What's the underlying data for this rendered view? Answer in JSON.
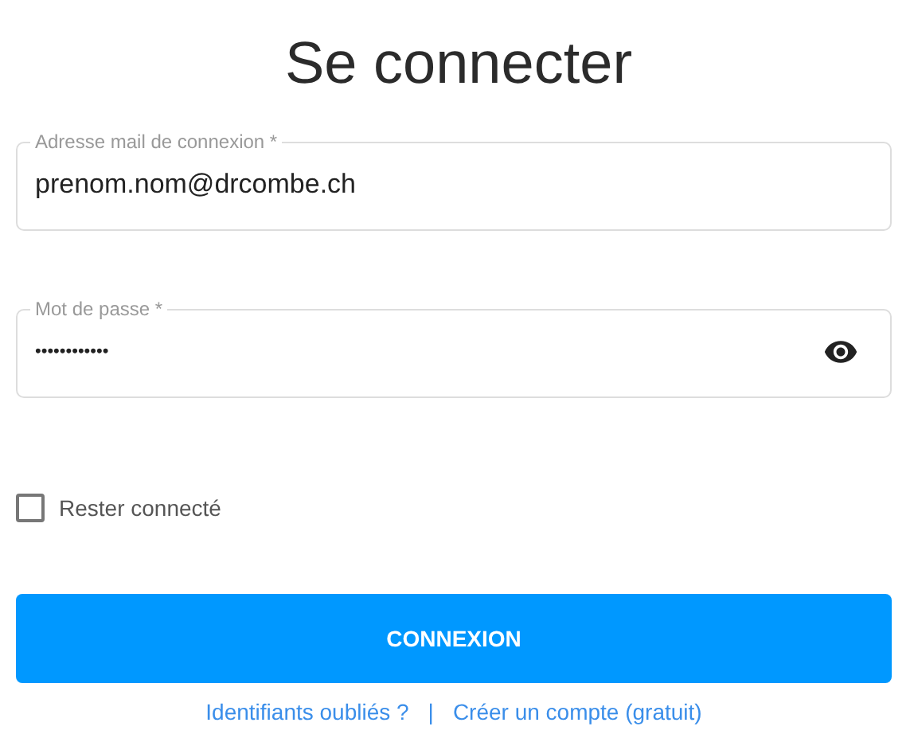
{
  "title": "Se connecter",
  "fields": [
    {
      "kind": "text",
      "label": "Adresse mail de connexion *",
      "value": "prenom.nom@drcombe.ch"
    },
    {
      "kind": "password",
      "label": "Mot de passe *",
      "value": "••••••••••••"
    }
  ],
  "remember": {
    "label": "Rester connecté",
    "checked": false
  },
  "submit": "CONNEXION",
  "links": [
    "Identifiants oubliés ?",
    "Créer un compte (gratuit)"
  ],
  "link_separator": "|"
}
